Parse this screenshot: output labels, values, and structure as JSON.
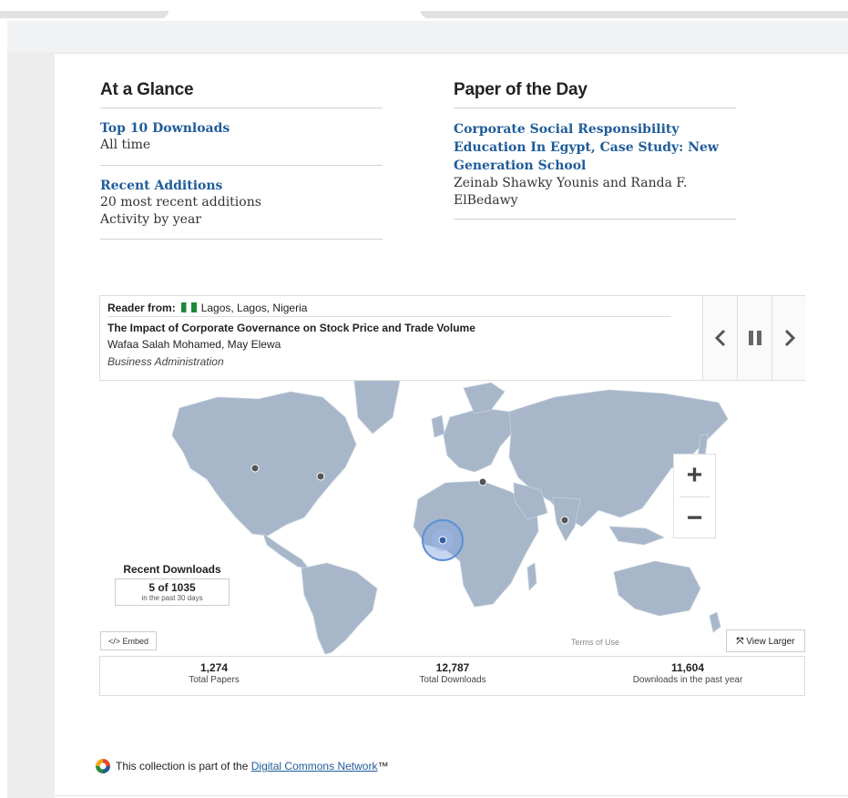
{
  "at_a_glance": {
    "heading": "At a Glance",
    "top10_link": "Top 10 Downloads",
    "top10_sub": "All time",
    "recent_link": "Recent Additions",
    "recent_sub1": "20 most recent additions",
    "recent_sub2": "Activity by year"
  },
  "paper_of_day": {
    "heading": "Paper of the Day",
    "title": "Corporate Social Responsibility Education In Egypt, Case Study: New Generation School",
    "authors": "Zeinab Shawky Younis and Randa F. ElBedawy"
  },
  "reader": {
    "label": "Reader from:",
    "location": "Lagos, Lagos, Nigeria",
    "title": "The Impact of Corporate Governance on Stock Price and Trade Volume",
    "authors": "Wafaa Salah Mohamed, May Elewa",
    "department": "Business Administration",
    "prev_icon": "chevron-left",
    "pause_icon": "pause",
    "next_icon": "chevron-right"
  },
  "map": {
    "zoom_in": "+",
    "zoom_out": "−",
    "recent_label": "Recent Downloads",
    "recent_count": "5 of 1035",
    "recent_period": "in the past 30 days",
    "embed": "</> Embed",
    "terms": "Terms of Use",
    "view_larger": "View Larger"
  },
  "stats": [
    {
      "num": "1,274",
      "cap": "Total Papers"
    },
    {
      "num": "12,787",
      "cap": "Total Downloads"
    },
    {
      "num": "11,604",
      "cap": "Downloads in the past year"
    }
  ],
  "footer": {
    "text": "This collection is part of the",
    "link": "Digital Commons Network",
    "tm": "™"
  },
  "colors": {
    "link": "#1f5c99",
    "land": "#a7b6c9",
    "accent_ring": "#5c8fd6"
  }
}
